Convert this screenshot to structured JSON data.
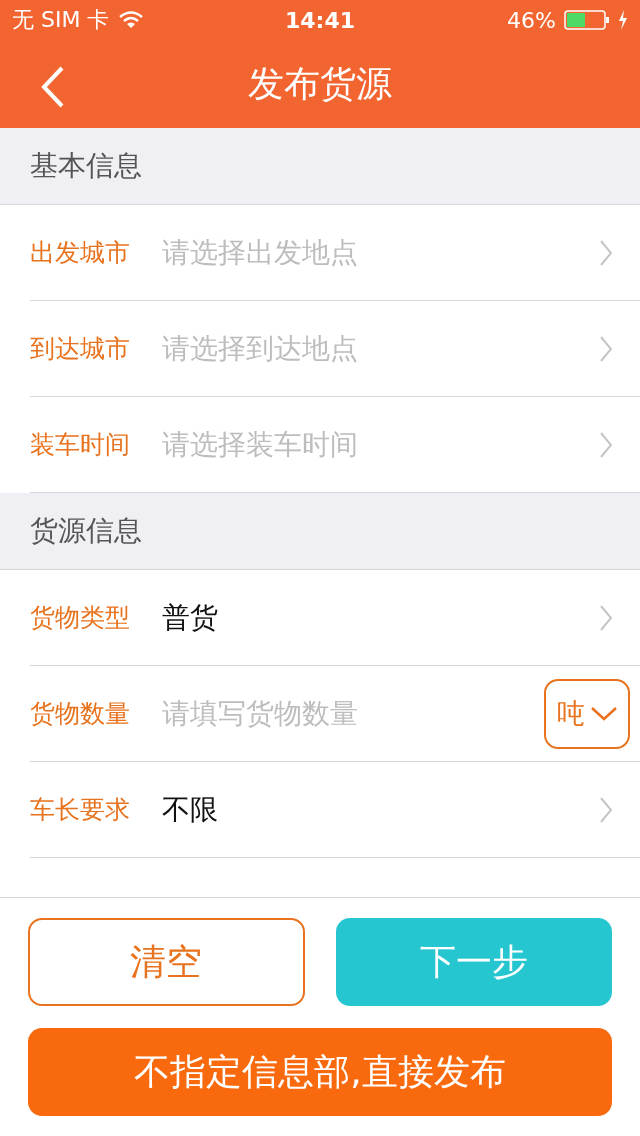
{
  "status_bar": {
    "carrier": "无 SIM 卡",
    "time": "14:41",
    "battery": "46%"
  },
  "nav_bar": {
    "title": "发布货源"
  },
  "sections": [
    {
      "title": "基本信息",
      "rows": [
        {
          "kind": "select",
          "label": "出发城市",
          "placeholder": "请选择出发地点"
        },
        {
          "kind": "select",
          "label": "到达城市",
          "placeholder": "请选择到达地点"
        },
        {
          "kind": "select",
          "label": "装车时间",
          "placeholder": "请选择装车时间"
        }
      ]
    },
    {
      "title": "货源信息",
      "rows": [
        {
          "kind": "select",
          "label": "货物类型",
          "value": "普货"
        },
        {
          "kind": "quantity",
          "label": "货物数量",
          "placeholder": "请填写货物数量",
          "unit": "吨"
        },
        {
          "kind": "select",
          "label": "车长要求",
          "value": "不限"
        }
      ]
    }
  ],
  "buttons": [
    {
      "kind": "outline",
      "label": "清空"
    },
    {
      "kind": "teal",
      "label": "下一步"
    },
    {
      "kind": "wide",
      "label": "不指定信息部,直接发布"
    }
  ]
}
